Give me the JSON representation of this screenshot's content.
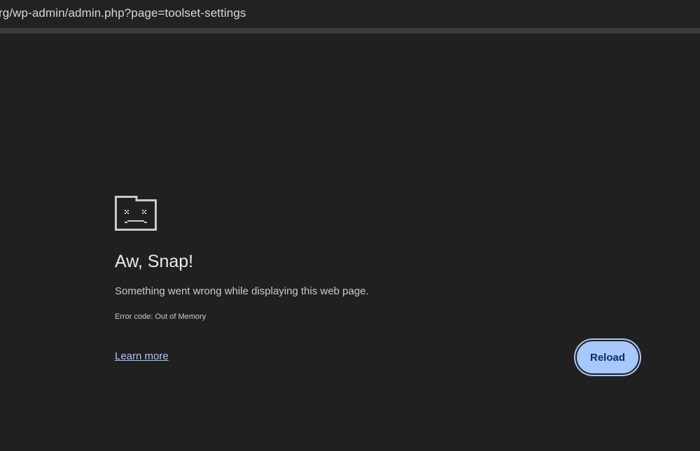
{
  "address_bar": {
    "url": "rg/wp-admin/admin.php?page=toolset-settings"
  },
  "error_page": {
    "icon": "sad-tab-icon",
    "title": "Aw, Snap!",
    "message": "Something went wrong while displaying this web page.",
    "error_code": "Error code: Out of Memory",
    "learn_more_label": "Learn more",
    "reload_label": "Reload"
  },
  "colors": {
    "background": "#202020",
    "accent": "#a8c7fa",
    "button_text": "#062e6f"
  }
}
